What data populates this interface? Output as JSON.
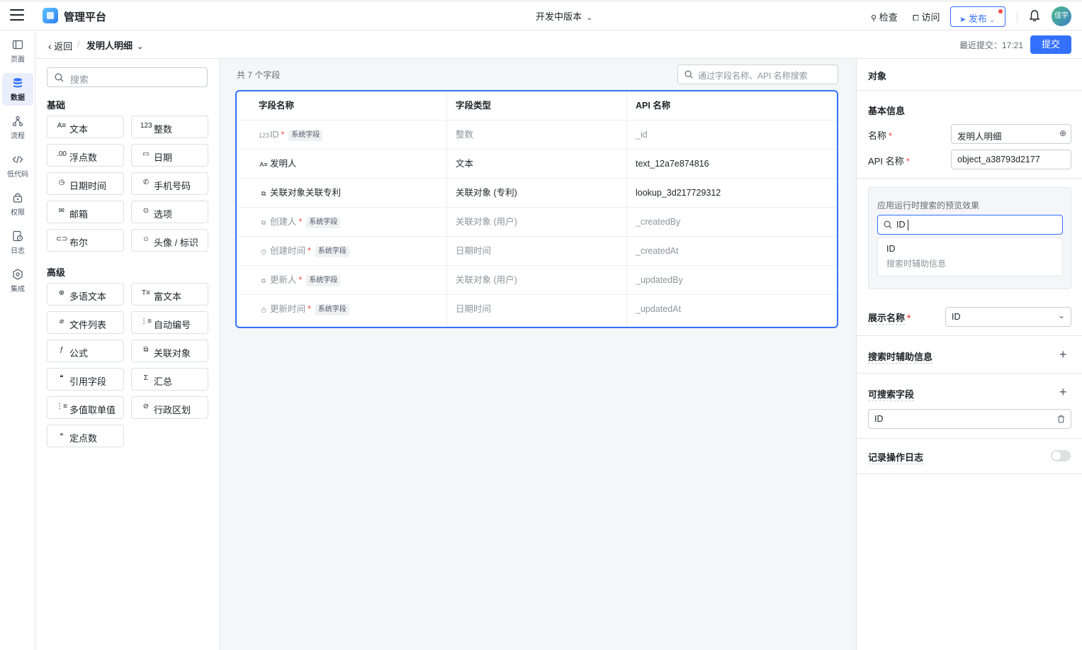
{
  "topbar": {
    "app_title": "管理平台",
    "version": "开发中版本",
    "check": "检查",
    "visit": "访问",
    "publish": "发布",
    "avatar_text": "佳宇"
  },
  "rail": [
    {
      "label": "页面",
      "icon": "page-icon"
    },
    {
      "label": "数据",
      "icon": "database-icon"
    },
    {
      "label": "流程",
      "icon": "flow-icon"
    },
    {
      "label": "低代码",
      "icon": "code-icon"
    },
    {
      "label": "权限",
      "icon": "lock-icon"
    },
    {
      "label": "日志",
      "icon": "log-icon"
    },
    {
      "label": "集成",
      "icon": "integration-icon"
    }
  ],
  "subhead": {
    "back": "返回",
    "current": "发明人明细",
    "last_commit": "最近提交：17:21",
    "submit": "提交"
  },
  "palette": {
    "search_placeholder": "搜索",
    "basic_title": "基础",
    "basic": [
      {
        "glyph": "A≡",
        "label": "文本"
      },
      {
        "glyph": "123",
        "label": "整数"
      },
      {
        "glyph": ".00",
        "label": "浮点数"
      },
      {
        "glyph": "▭",
        "label": "日期"
      },
      {
        "glyph": "◷",
        "label": "日期时间"
      },
      {
        "glyph": "✆",
        "label": "手机号码"
      },
      {
        "glyph": "✉",
        "label": "邮箱"
      },
      {
        "glyph": "⊙",
        "label": "选项"
      },
      {
        "glyph": "⊂⊃",
        "label": "布尔"
      },
      {
        "glyph": "☺",
        "label": "头像 / 标识"
      }
    ],
    "advanced_title": "高级",
    "advanced": [
      {
        "glyph": "⊕",
        "label": "多语文本"
      },
      {
        "glyph": "T≡",
        "label": "富文本"
      },
      {
        "glyph": "⌀",
        "label": "文件列表"
      },
      {
        "glyph": "⋮≡",
        "label": "自动编号"
      },
      {
        "glyph": "ƒ",
        "label": "公式"
      },
      {
        "glyph": "⧉",
        "label": "关联对象"
      },
      {
        "glyph": "❝",
        "label": "引用字段"
      },
      {
        "glyph": "Σ",
        "label": "汇总"
      },
      {
        "glyph": "⋮≡",
        "label": "多值取单值"
      },
      {
        "glyph": "⊘",
        "label": "行政区划"
      },
      {
        "glyph": "⌖",
        "label": "定点数"
      }
    ]
  },
  "main": {
    "count": "共 7 个字段",
    "search_placeholder": "通过字段名称、API 名称搜索",
    "headers": [
      "字段名称",
      "字段类型",
      "API 名称"
    ],
    "rows": [
      {
        "glyph": "123",
        "name": "ID",
        "required": "*",
        "tag": "系统字段",
        "type": "整数",
        "api": "_id",
        "system": true
      },
      {
        "glyph": "A≡",
        "name": "发明人",
        "required": "",
        "tag": "",
        "type": "文本",
        "api": "text_12a7e874816",
        "system": false
      },
      {
        "glyph": "⧉",
        "name": "关联对象关联专利",
        "required": "",
        "tag": "",
        "type": "关联对象 (专利)",
        "api": "lookup_3d217729312",
        "system": false
      },
      {
        "glyph": "⧉",
        "name": "创建人",
        "required": "*",
        "tag": "系统字段",
        "type": "关联对象 (用户)",
        "api": "_createdBy",
        "system": true
      },
      {
        "glyph": "◷",
        "name": "创建时间",
        "required": "*",
        "tag": "系统字段",
        "type": "日期时间",
        "api": "_createdAt",
        "system": true
      },
      {
        "glyph": "⧉",
        "name": "更新人",
        "required": "*",
        "tag": "系统字段",
        "type": "关联对象 (用户)",
        "api": "_updatedBy",
        "system": true
      },
      {
        "glyph": "◷",
        "name": "更新时间",
        "required": "*",
        "tag": "系统字段",
        "type": "日期时间",
        "api": "_updatedAt",
        "system": true
      }
    ]
  },
  "right": {
    "title": "对象",
    "basic_info": "基本信息",
    "name_label": "名称",
    "name_value": "发明人明细",
    "api_label": "API 名称",
    "api_value": "object_a38793d2177",
    "required": "*",
    "preview_title": "应用运行时搜索的预览效果",
    "preview_input": "ID",
    "preview_result": "ID",
    "preview_sub": "搜索时辅助信息",
    "display_label": "展示名称",
    "display_value": "ID",
    "search_aux": "搜索时辅助信息",
    "searchable": "可搜索字段",
    "searchable_item": "ID",
    "log": "记录操作日志"
  }
}
